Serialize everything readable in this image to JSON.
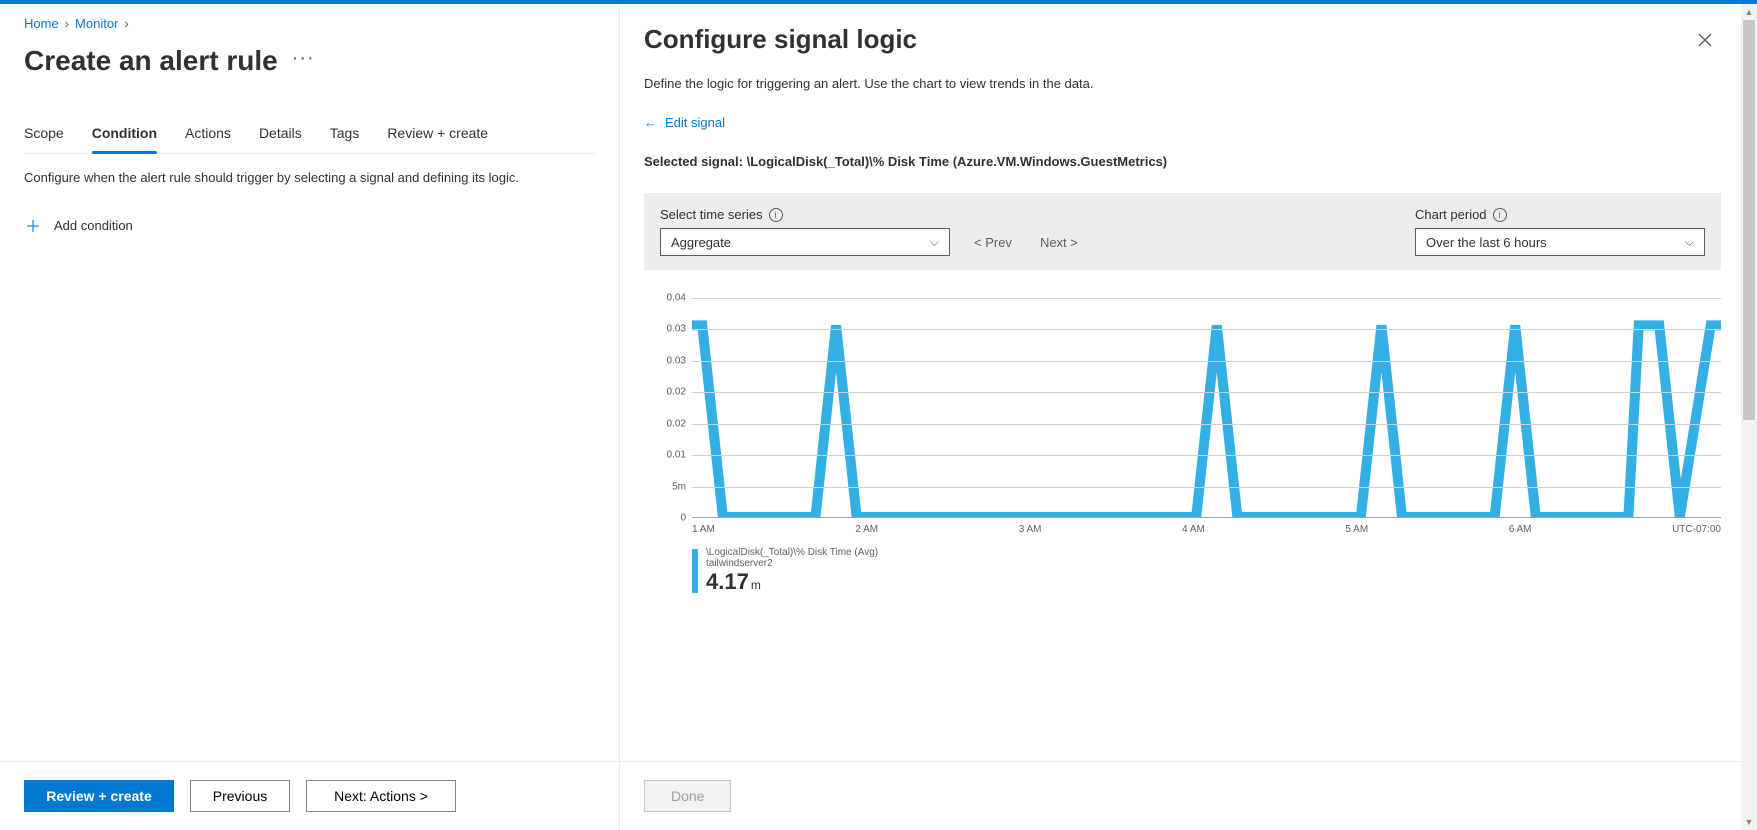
{
  "breadcrumbs": {
    "home": "Home",
    "monitor": "Monitor"
  },
  "page_title": "Create an alert rule",
  "tabs": {
    "scope": "Scope",
    "condition": "Condition",
    "actions": "Actions",
    "details": "Details",
    "tags": "Tags",
    "review": "Review + create"
  },
  "tab_desc": "Configure when the alert rule should trigger by selecting a signal and defining its logic.",
  "add_condition": "Add condition",
  "footer": {
    "review": "Review + create",
    "previous": "Previous",
    "next": "Next: Actions >"
  },
  "panel": {
    "title": "Configure signal logic",
    "desc": "Define the logic for triggering an alert. Use the chart to view trends in the data.",
    "edit_signal": "Edit signal",
    "selected_label": "Selected signal: ",
    "selected_value": "\\LogicalDisk(_Total)\\% Disk Time (Azure.VM.Windows.GuestMetrics)",
    "time_series_label": "Select time series",
    "aggregate": "Aggregate",
    "prev": "< Prev",
    "next": "Next >",
    "chart_period_label": "Chart period",
    "chart_period_value": "Over the last 6 hours",
    "done": "Done"
  },
  "legend": {
    "line1": "\\LogicalDisk(_Total)\\% Disk Time (Avg)",
    "line2": "tailwindserver2",
    "value": "4.17",
    "unit": "m"
  },
  "chart_data": {
    "type": "line",
    "title": "",
    "xlabel": "",
    "ylabel": "",
    "y_ticks": [
      "0.04",
      "0.03",
      "0.03",
      "0.02",
      "0.02",
      "0.01",
      "5m",
      "0"
    ],
    "ylim": [
      0,
      0.04
    ],
    "x_ticks": [
      "1 AM",
      "2 AM",
      "3 AM",
      "4 AM",
      "5 AM",
      "6 AM"
    ],
    "timezone": "UTC-07:00",
    "series": [
      {
        "name": "\\LogicalDisk(_Total)\\% Disk Time (Avg) — tailwindserver2",
        "color": "#32b0e6",
        "x": [
          0.0,
          0.01,
          0.03,
          0.12,
          0.14,
          0.16,
          0.49,
          0.51,
          0.53,
          0.65,
          0.67,
          0.69,
          0.78,
          0.8,
          0.82,
          0.91,
          0.92,
          0.94,
          0.96,
          0.99,
          1.0
        ],
        "values": [
          0.035,
          0.035,
          0,
          0,
          0.035,
          0,
          0,
          0.035,
          0,
          0,
          0.035,
          0,
          0,
          0.035,
          0,
          0,
          0.035,
          0.035,
          0,
          0.035,
          0.035
        ]
      }
    ]
  }
}
